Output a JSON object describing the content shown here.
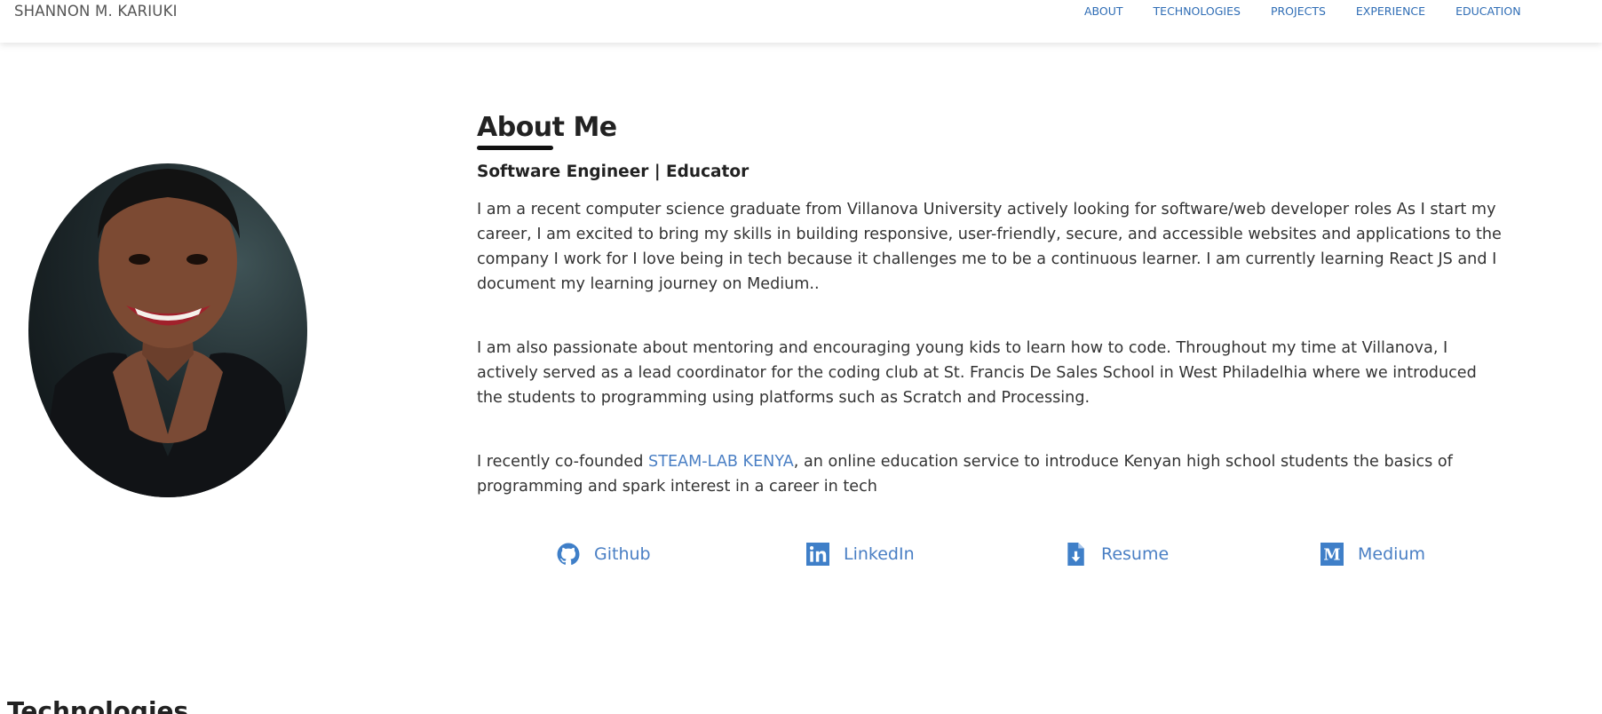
{
  "navbar": {
    "brand": "SHANNON M. KARIUKI",
    "links": [
      "ABOUT",
      "TECHNOLOGIES",
      "PROJECTS",
      "EXPERIENCE",
      "EDUCATION"
    ]
  },
  "about": {
    "heading": "About Me",
    "subtitle": "Software Engineer | Educator",
    "para1": "I am a recent computer science graduate from Villanova University actively looking for software/web developer roles As I start my career, I am excited to bring my skills in building responsive, user-friendly, secure, and accessible websites and applications to the company I work for I love being in tech because it challenges me to be a continuous learner. I am currently learning React JS and I document my learning journey on Medium..",
    "para2": "I am also passionate about mentoring and encouraging young kids to learn how to code. Throughout my time at Villanova, I actively served as a lead coordinator for the coding club at St. Francis De Sales School in West Philadelhia where we introduced the students to programming using platforms such as Scratch and Processing.",
    "para3_prefix": "I recently co-founded ",
    "para3_link": "STEAM-LAB KENYA",
    "para3_suffix": ", an online education service to introduce Kenyan high school students the basics of programming and spark interest in a career in tech"
  },
  "social_links": [
    {
      "label": "Github",
      "icon": "github-icon"
    },
    {
      "label": "LinkedIn",
      "icon": "linkedin-icon"
    },
    {
      "label": "Resume",
      "icon": "file-download-icon"
    },
    {
      "label": "Medium",
      "icon": "medium-icon"
    }
  ],
  "next_section": {
    "heading": "Technologies"
  },
  "colors": {
    "link": "#4a7fc4",
    "nav_link": "#2f6db5",
    "text": "#333333",
    "heading": "#222222"
  }
}
